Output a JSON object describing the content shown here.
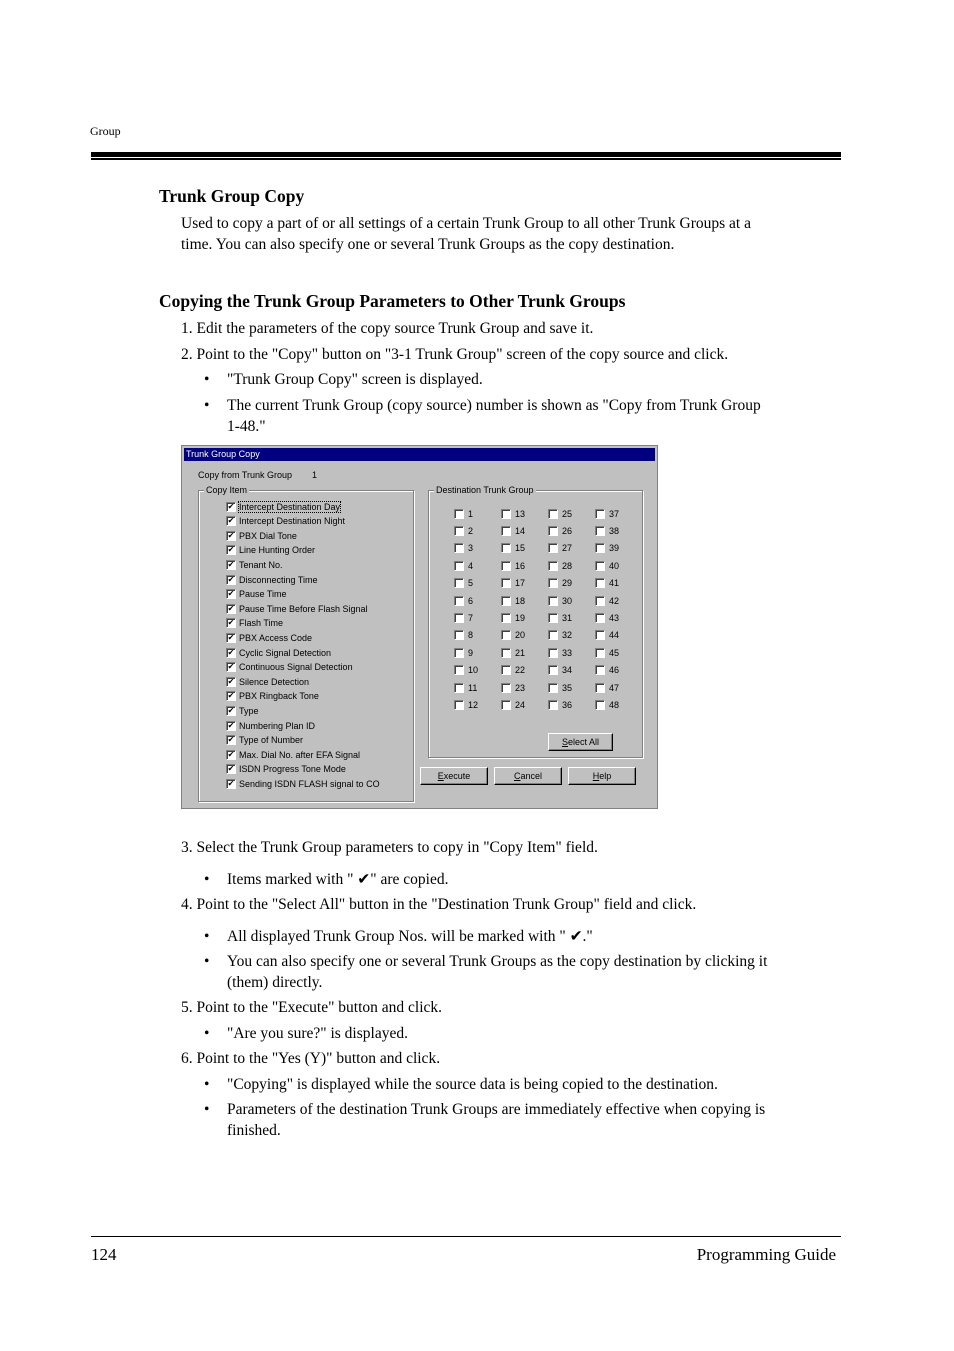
{
  "header": {
    "running_head": "Group"
  },
  "section": {
    "title": "Trunk Group Copy",
    "intro_line1": "Used to copy a part of or all settings of a certain Trunk Group to all other Trunk Groups at a",
    "intro_line2": "time. You can also specify one or several Trunk Groups as the copy destination."
  },
  "subsection": {
    "title": "Copying the Trunk Group Parameters to Other Trunk Groups",
    "step1": "1. Edit the parameters of the copy source Trunk Group and save it.",
    "step2": "2. Point to the \"Copy\" button on \"3-1 Trunk Group\" screen of the copy source and click.",
    "step2_b1": "\"Trunk Group Copy\" screen is displayed.",
    "step2_b2_l1": "The current Trunk Group (copy source) number is shown as \"Copy from Trunk Group",
    "step2_b2_l2": "1-48.\"",
    "step3": "3. Select the Trunk Group parameters to copy in \"Copy Item\" field.",
    "step3_b1": "Items marked with \" ✔\" are copied.",
    "step4": "4. Point to the \"Select All\" button in the \"Destination Trunk Group\" field and click.",
    "step4_b1": "All displayed Trunk Group Nos. will be marked with \" ✔.\"",
    "step4_b2_l1": "You can also specify one or several Trunk Groups as the copy destination by clicking it",
    "step4_b2_l2": "(them) directly.",
    "step5": "5. Point to the \"Execute\" button and click.",
    "step5_b1": "\"Are you sure?\" is displayed.",
    "step6": "6. Point to the \"Yes (Y)\" button and click.",
    "step6_b1": "\"Copying\" is displayed while the source data is being copied to the destination.",
    "step6_b2_l1": "Parameters of the destination Trunk Groups are immediately effective when copying is",
    "step6_b2_l2": "finished.",
    "bullet_glyph": "•"
  },
  "dialog": {
    "title": "Trunk Group Copy",
    "copy_from_label": "Copy from Trunk Group",
    "copy_from_value": "1",
    "copy_item_label": "Copy Item",
    "copy_items": [
      {
        "label": "Intercept Destination Day",
        "checked": true
      },
      {
        "label": "Intercept Destination Night",
        "checked": true
      },
      {
        "label": "PBX Dial Tone",
        "checked": true
      },
      {
        "label": "Line Hunting Order",
        "checked": true
      },
      {
        "label": "Tenant No.",
        "checked": true
      },
      {
        "label": "Disconnecting Time",
        "checked": true
      },
      {
        "label": "Pause Time",
        "checked": true
      },
      {
        "label": "Pause Time Before Flash Signal",
        "checked": true
      },
      {
        "label": "Flash Time",
        "checked": true
      },
      {
        "label": "PBX Access Code",
        "checked": true
      },
      {
        "label": "Cyclic Signal Detection",
        "checked": true
      },
      {
        "label": "Continuous Signal Detection",
        "checked": true
      },
      {
        "label": "Silence Detection",
        "checked": true
      },
      {
        "label": "PBX Ringback Tone",
        "checked": true
      },
      {
        "label": "Type",
        "checked": true
      },
      {
        "label": "Numbering Plan ID",
        "checked": true
      },
      {
        "label": "Type of Number",
        "checked": true
      },
      {
        "label": "Max. Dial No. after EFA Signal",
        "checked": true
      },
      {
        "label": "ISDN Progress Tone Mode",
        "checked": true
      },
      {
        "label": "Sending ISDN FLASH signal to CO",
        "checked": true
      }
    ],
    "destination_label": "Destination Trunk Group",
    "destination_groups": [
      "1",
      "2",
      "3",
      "4",
      "5",
      "6",
      "7",
      "8",
      "9",
      "10",
      "11",
      "12",
      "13",
      "14",
      "15",
      "16",
      "17",
      "18",
      "19",
      "20",
      "21",
      "22",
      "23",
      "24",
      "25",
      "26",
      "27",
      "28",
      "29",
      "30",
      "31",
      "32",
      "33",
      "34",
      "35",
      "36",
      "37",
      "38",
      "39",
      "40",
      "41",
      "42",
      "43",
      "44",
      "45",
      "46",
      "47",
      "48"
    ],
    "destination_checked": [],
    "select_all": {
      "mnemonic": "S",
      "rest": "elect All"
    },
    "execute": {
      "mnemonic": "E",
      "rest": "xecute"
    },
    "cancel": {
      "mnemonic": "C",
      "rest": "ancel"
    },
    "help": {
      "mnemonic": "H",
      "rest": "elp"
    },
    "check_glyph": "✔"
  },
  "footer": {
    "page_number": "124",
    "book_title": "Programming Guide"
  }
}
